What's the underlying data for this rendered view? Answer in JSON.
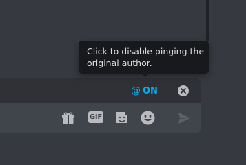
{
  "tooltip": {
    "line1": "Click to disable pinging the",
    "line2": "original author."
  },
  "reply_bar": {
    "mention_prefix": "@",
    "mention_state": "ON",
    "mention_color": "#00b0f4"
  },
  "composer": {
    "buttons": {
      "gift": "gift-icon",
      "gif_label": "GIF",
      "sticker": "sticker-icon",
      "emoji": "emoji-icon",
      "send": "send-icon"
    }
  }
}
